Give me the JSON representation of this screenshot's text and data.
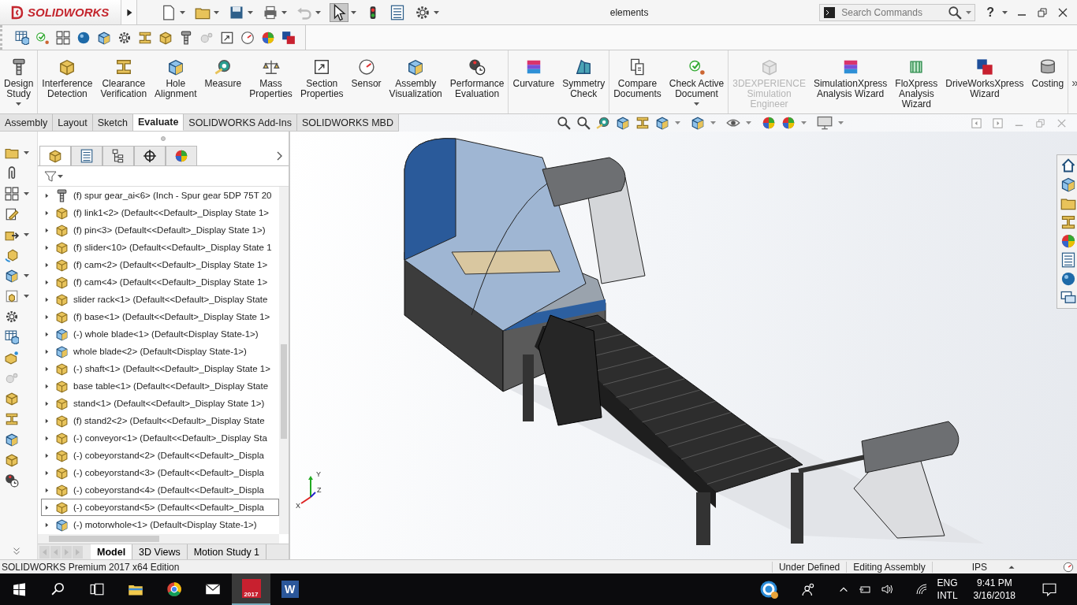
{
  "app": {
    "logo": "SOLIDWORKS"
  },
  "window": {
    "title": "elements"
  },
  "quick_access": {
    "select_active": true
  },
  "search": {
    "placeholder": "Search Commands"
  },
  "help": {
    "label": "?"
  },
  "ribbon": {
    "overflow": "»",
    "groups": [
      [
        {
          "label": "Design\nStudy",
          "dropdown": true,
          "disabled": false
        }
      ],
      [
        {
          "label": "Interference\nDetection",
          "dropdown": false,
          "disabled": false
        },
        {
          "label": "Clearance\nVerification",
          "dropdown": false,
          "disabled": false
        },
        {
          "label": "Hole\nAlignment",
          "dropdown": false,
          "disabled": false
        },
        {
          "label": "Measure",
          "dropdown": false,
          "disabled": false
        },
        {
          "label": "Mass\nProperties",
          "dropdown": false,
          "disabled": false
        },
        {
          "label": "Section\nProperties",
          "dropdown": false,
          "disabled": false
        },
        {
          "label": "Sensor",
          "dropdown": false,
          "disabled": false
        },
        {
          "label": "Assembly\nVisualization",
          "dropdown": false,
          "disabled": false
        },
        {
          "label": "Performance\nEvaluation",
          "dropdown": false,
          "disabled": false
        }
      ],
      [
        {
          "label": "Curvature",
          "dropdown": false,
          "disabled": false
        },
        {
          "label": "Symmetry\nCheck",
          "dropdown": false,
          "disabled": false
        }
      ],
      [
        {
          "label": "Compare\nDocuments",
          "dropdown": false,
          "disabled": false
        },
        {
          "label": "Check Active\nDocument",
          "dropdown": true,
          "disabled": false
        }
      ],
      [
        {
          "label": "3DEXPERIENCE\nSimulation\nEngineer",
          "dropdown": false,
          "disabled": true
        },
        {
          "label": "SimulationXpress\nAnalysis Wizard",
          "dropdown": false,
          "disabled": false
        },
        {
          "label": "FloXpress\nAnalysis\nWizard",
          "dropdown": false,
          "disabled": false
        },
        {
          "label": "DriveWorksXpress\nWizard",
          "dropdown": false,
          "disabled": false
        },
        {
          "label": "Costing",
          "dropdown": false,
          "disabled": false
        }
      ]
    ]
  },
  "command_tabs": [
    {
      "label": "Assembly",
      "selected": false
    },
    {
      "label": "Layout",
      "selected": false
    },
    {
      "label": "Sketch",
      "selected": false
    },
    {
      "label": "Evaluate",
      "selected": true
    },
    {
      "label": "SOLIDWORKS Add-Ins",
      "selected": false
    },
    {
      "label": "SOLIDWORKS MBD",
      "selected": false
    }
  ],
  "feature_manager": {
    "panel_tabs": [
      {
        "selected": true
      },
      {
        "selected": false
      },
      {
        "selected": false
      },
      {
        "selected": false
      },
      {
        "selected": false
      }
    ],
    "tree": [
      {
        "label": "(f) spur gear_ai<6> (Inch - Spur gear 5DP 75T 20",
        "kind": "toolbox",
        "selected": false
      },
      {
        "label": "(f) link1<2> (Default<<Default>_Display State 1>",
        "kind": "part",
        "selected": false
      },
      {
        "label": "(f) pin<3> (Default<<Default>_Display State 1>)",
        "kind": "part",
        "selected": false
      },
      {
        "label": "(f) slider<10> (Default<<Default>_Display State 1",
        "kind": "part",
        "selected": false
      },
      {
        "label": "(f) cam<2> (Default<<Default>_Display State 1>",
        "kind": "part",
        "selected": false
      },
      {
        "label": "(f) cam<4> (Default<<Default>_Display State 1>",
        "kind": "part",
        "selected": false
      },
      {
        "label": "slider rack<1> (Default<<Default>_Display State",
        "kind": "part",
        "selected": false
      },
      {
        "label": "(f) base<1> (Default<<Default>_Display State 1>",
        "kind": "part",
        "selected": false
      },
      {
        "label": "(-) whole blade<1> (Default<Display State-1>)",
        "kind": "assembly",
        "selected": false
      },
      {
        "label": "whole blade<2> (Default<Display State-1>)",
        "kind": "assembly",
        "selected": false
      },
      {
        "label": "(-) shaft<1> (Default<<Default>_Display State 1>",
        "kind": "part",
        "selected": false
      },
      {
        "label": "base table<1> (Default<<Default>_Display State",
        "kind": "part",
        "selected": false
      },
      {
        "label": "stand<1> (Default<<Default>_Display State 1>)",
        "kind": "part",
        "selected": false
      },
      {
        "label": "(f) stand2<2> (Default<<Default>_Display State",
        "kind": "part",
        "selected": false
      },
      {
        "label": "(-) conveyor<1> (Default<<Default>_Display Sta",
        "kind": "part",
        "selected": false
      },
      {
        "label": "(-) cobeyorstand<2> (Default<<Default>_Displa",
        "kind": "part",
        "selected": false
      },
      {
        "label": "(-) cobeyorstand<3> (Default<<Default>_Displa",
        "kind": "part",
        "selected": false
      },
      {
        "label": "(-) cobeyorstand<4> (Default<<Default>_Displa",
        "kind": "part",
        "selected": false
      },
      {
        "label": "(-) cobeyorstand<5> (Default<<Default>_Displa",
        "kind": "part",
        "selected": true
      },
      {
        "label": "(-) motorwhole<1> (Default<Display State-1>)",
        "kind": "assembly",
        "selected": false
      }
    ]
  },
  "view_tabs": [
    {
      "label": "Model",
      "selected": true
    },
    {
      "label": "3D Views",
      "selected": false
    },
    {
      "label": "Motion Study 1",
      "selected": false
    }
  ],
  "viewport": {
    "triad": {
      "y": "Y",
      "z": "Z",
      "x": "X"
    }
  },
  "status_bar": {
    "product": "SOLIDWORKS Premium 2017 x64 Edition",
    "sketch_state": "Under Defined",
    "mode": "Editing Assembly",
    "units": "IPS"
  },
  "taskbar": {
    "solidworks_badge": "2017",
    "word_badge": "W",
    "language": "ENG",
    "keyboard": "INTL",
    "time": "9:41 PM",
    "date": "3/16/2018"
  }
}
